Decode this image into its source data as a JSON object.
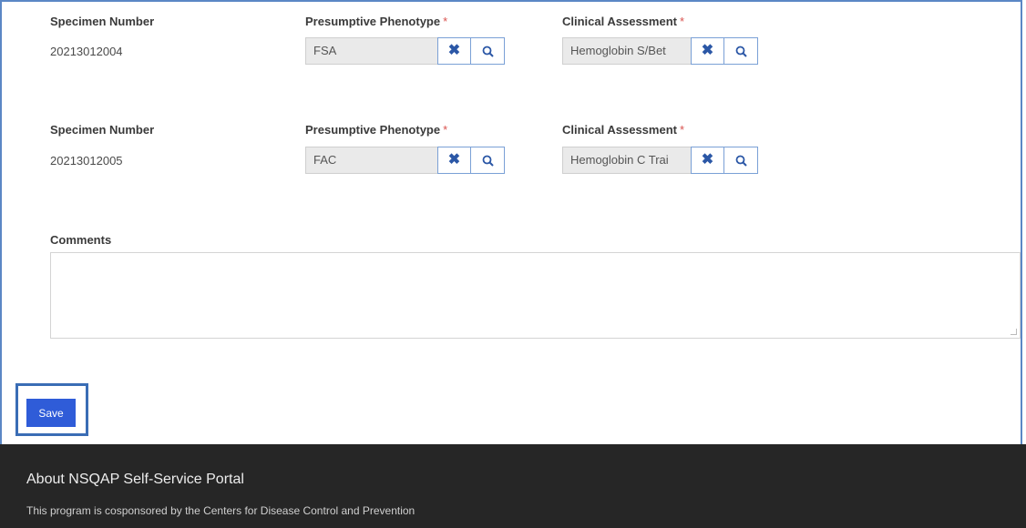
{
  "rows": [
    {
      "specimen_label": "Specimen Number",
      "specimen_value": "20213012004",
      "phenotype_label": "Presumptive Phenotype",
      "phenotype_value": "FSA",
      "assessment_label": "Clinical Assessment",
      "assessment_value": "Hemoglobin S/Bet"
    },
    {
      "specimen_label": "Specimen Number",
      "specimen_value": "20213012005",
      "phenotype_label": "Presumptive Phenotype",
      "phenotype_value": "FAC",
      "assessment_label": "Clinical Assessment",
      "assessment_value": "Hemoglobin C Trai"
    }
  ],
  "required_marker": "*",
  "comments": {
    "label": "Comments",
    "value": ""
  },
  "save_label": "Save",
  "footer": {
    "title": "About NSQAP Self-Service Portal",
    "text": "This program is cosponsored by the Centers for Disease Control and Prevention"
  },
  "icons": {
    "clear": "close-icon",
    "lookup": "search-icon"
  },
  "colors": {
    "accent": "#2f5cd8",
    "icon": "#2b57a6",
    "required": "#d9534f",
    "footer_bg": "#262626",
    "highlight": "#3a6db5"
  }
}
